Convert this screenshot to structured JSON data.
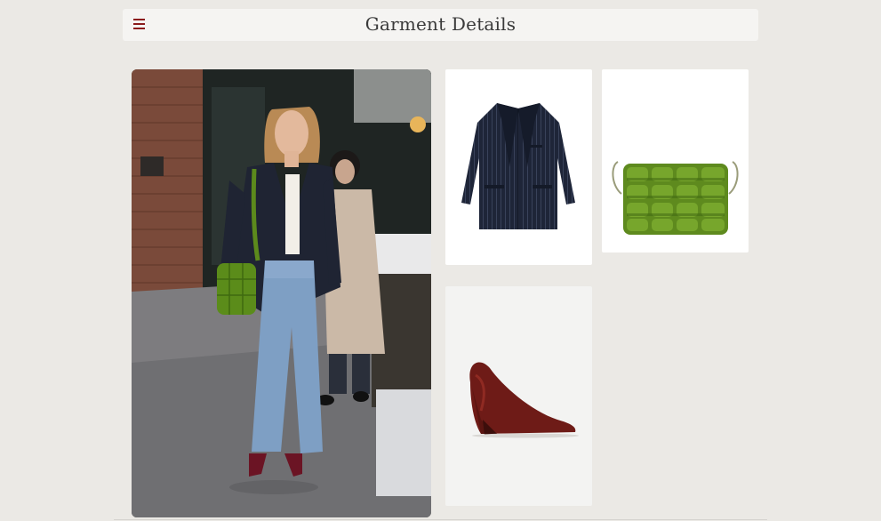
{
  "header": {
    "title": "Garment Details",
    "menu_icon": "hamburger-menu-icon"
  },
  "colors": {
    "background": "#ebe9e5",
    "header_bg": "#f5f4f2",
    "accent": "#8b1c1c",
    "title_text": "#3a3a3a"
  },
  "items": [
    {
      "id": "blazer",
      "icon": "navy-pinstripe-blazer"
    },
    {
      "id": "bag",
      "icon": "green-woven-crossbody-bag"
    },
    {
      "id": "shoe",
      "icon": "burgundy-wedge-pump"
    }
  ]
}
